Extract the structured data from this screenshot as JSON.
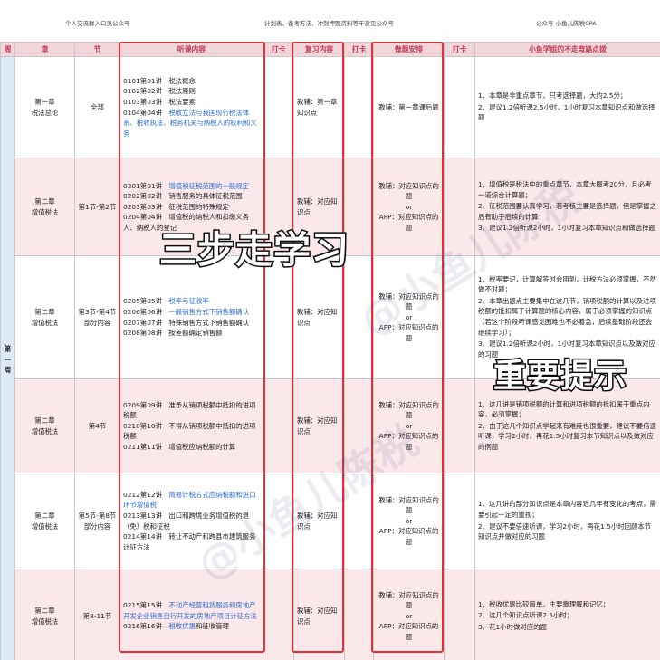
{
  "header_notes": [
    "个人交流群入口见公众号",
    "计划表、备考方法、冲刺押题资料等干货见公众号",
    "公众号 小鱼儿陈税CPA"
  ],
  "columns": [
    "周",
    "章",
    "节",
    "听课内容",
    "打卡",
    "复习内容",
    "打卡",
    "做题安排",
    "打卡",
    "小鱼学姐的不走弯路点拨"
  ],
  "week_label": "第一周",
  "rows": [
    {
      "chapter": "第一章\n税法总论",
      "section": "全部",
      "lectures": [
        {
          "text": "0101第01讲　税法概念",
          "hl": false
        },
        {
          "text": "0102第02讲　税法原则",
          "hl": false
        },
        {
          "text": "0103第03讲　税法要素",
          "hl": false
        },
        {
          "text": "0104第04讲　",
          "hl": false,
          "tail": "税收立法与我国现行税法体系、税收执法、税务机关与纳税人的权利和义务",
          "tail_hl": true
        }
      ],
      "review": "教辅：第一章知识点",
      "practice": "教辅：第一章课后题",
      "tips": [
        "1、本章是非重点章节，只考选择题，大约2.5分；",
        "2、建议1.2倍听课2.5小时，1小时复习本章知识点和做选择题"
      ],
      "style": "white"
    },
    {
      "chapter": "第二章\n增值税法",
      "section": "第1节-第2节",
      "lectures": [
        {
          "text": "0201第01讲　",
          "tail": "增值税征税范围的一般规定",
          "tail_hl": true
        },
        {
          "text": "0202第02讲　销售服务的具体征税范围"
        },
        {
          "text": "0203第03讲　征税范围的特殊规定"
        },
        {
          "text": "0204第04讲　增值税的纳税人和扣缴义务人、纳税人的登记"
        }
      ],
      "review": "教辅：对应知识点",
      "practice": "教辅：对应知识点的题\nor\nAPP：对应知识点的题",
      "tips": [
        "1、增值税是税法中的重点章节，本章大概考20分，且必考一道综合计算题；",
        "2、征税范围要认真学习，若考核主要是选择题，但是掌握之后有助于后续的计算；",
        "3、建议1.2倍听课2小时，1小时复习本章知识点和做选择题"
      ],
      "style": "pink"
    },
    {
      "chapter": "第二章\n增值税法",
      "section": "第3节-第4节部分内容",
      "lectures": [
        {
          "text": "0205第05讲　",
          "tail": "税率与征收率",
          "tail_hl": true
        },
        {
          "text": "0206第06讲　",
          "tail": "一般销售方式下销售额确认",
          "tail_hl": true
        },
        {
          "text": "0207第07讲　特殊销售方式下销售额确认"
        },
        {
          "text": "0208第08讲　按差额确定销售额"
        }
      ],
      "review": "教辅：对应知识点",
      "practice": "教辅：对应知识点的题\nor\nAPP：对应知识点的题",
      "tips": [
        "1、税率要记，计算解答时会用到，计税方法必须掌握，不然做不对题；",
        "2、本章出题点主要集中在这几节，销项税额的计算以及进项税额的抵扣属于计算题的核心内容，属于必须掌握的知识点（若这个阶段听课感觉困难也不必着急，后续基础阶段还会继续学习）；",
        "3、建议1.2倍听课2小时，1小时复习本章知识点以及做对应的习题"
      ],
      "style": "white"
    },
    {
      "chapter": "第二章\n增值税法",
      "section": "第4节",
      "lectures": [
        {
          "text": "0209第09讲　准予从销项税额中抵扣的进项税额"
        },
        {
          "text": "0210第10讲　不得从销项税额中抵扣的进项税额"
        },
        {
          "text": "0211第11讲　增值税应纳税额的计算"
        }
      ],
      "review": "教辅：对应知识点",
      "practice": "教辅：对应知识点的题\nor\nAPP：对应知识点的题",
      "tips": [
        "1、这几讲是销项税额的计算和进项税额的抵扣属于重点内容，必须掌握；",
        "2、由于这几个知识点学起来有难度也很重要，建议不要倍速听课，学习2小时，再花1.5小时复习本节知识点以及做对应的例题"
      ],
      "style": "pink"
    },
    {
      "chapter": "第二章\n增值税法",
      "section": "第5节-第8节部分内容",
      "lectures": [
        {
          "text": "0212第12讲　",
          "tail": "简易计税方式应纳税额和进口环节增值税",
          "tail_hl": true
        },
        {
          "text": "0213第13讲　出口和跨境业务增值税的退（免）税和征税"
        },
        {
          "text": "0214第14讲　转让不动产和跨县市建筑服务计征方法"
        }
      ],
      "review": "教辅：对应知识点",
      "practice": "教辅：对应知识点的题\nor\nAPP：对应知识点的题",
      "tips": [
        "1、这几讲的部分知识点是本章内容近几年有变化的考点，需要引起一定的重视；",
        "2、建议不要倍速听课，学习2小时，再花1.5小时回顾本节知识点并做对应的习题"
      ],
      "style": "white"
    },
    {
      "chapter": "第二章\n增值税法",
      "section": "第8-11节",
      "lectures": [
        {
          "text": "0215第15讲　",
          "tail": "不动产经营租赁服务和房地产开发企业销售自行开发的房地产项目计征方法",
          "tail_hl": true
        },
        {
          "text": "0216第16讲　",
          "tail": "税收优惠",
          "tail_hl": true,
          "after": "和征收管理"
        }
      ],
      "review": "教辅：对应知识点",
      "practice": "教辅：对应知识点的题\nor\nAPP：对应知识点的题",
      "tips": [
        "1、税收优惠比较简单，主要靠理解和记忆；",
        "2、这几个知识点听课2.5小时；",
        "3、花1小时做对应的题"
      ],
      "style": "pink"
    }
  ],
  "overlay_text_1": "三步走学习",
  "overlay_text_2": "重要提示",
  "watermark": "@小鱼儿陈税"
}
